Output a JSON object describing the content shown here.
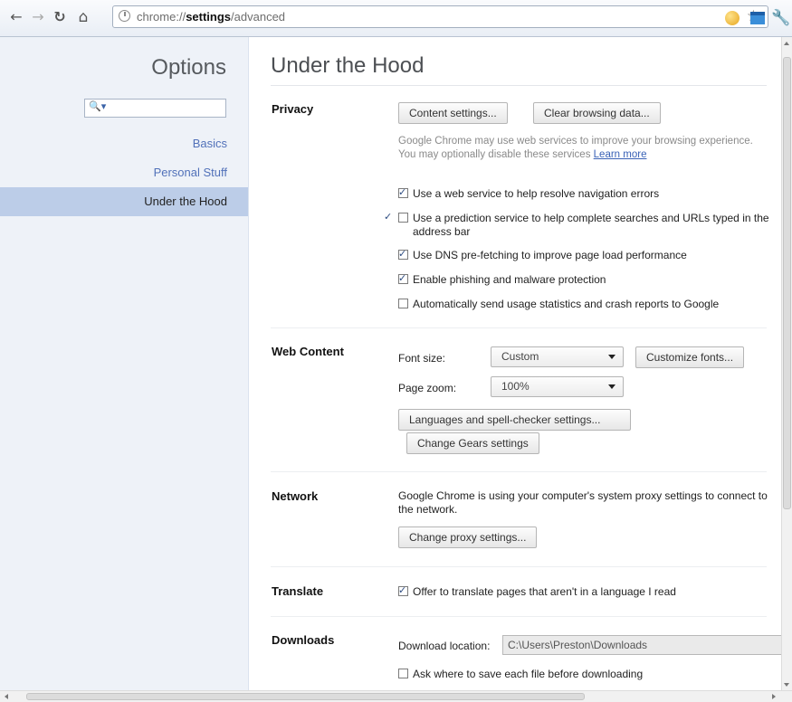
{
  "toolbar": {
    "back_icon": "back-arrow-icon",
    "forward_icon": "forward-arrow-icon",
    "reload_icon": "reload-icon",
    "home_icon": "home-icon",
    "url_scheme": "chrome://",
    "url_host": "settings",
    "url_path": "/advanced",
    "bookmark_icon": "star-icon",
    "extension_icons": [
      "smiley-extension-icon",
      "calendar-extension-icon"
    ],
    "menu_icon": "wrench-icon"
  },
  "sidebar": {
    "title": "Options",
    "search": {
      "value": "",
      "placeholder": ""
    },
    "items": [
      {
        "label": "Basics",
        "active": false
      },
      {
        "label": "Personal Stuff",
        "active": false
      },
      {
        "label": "Under the Hood",
        "active": true
      }
    ]
  },
  "main": {
    "title": "Under the Hood",
    "privacy": {
      "heading": "Privacy",
      "content_settings_button": "Content settings...",
      "clear_browsing_button": "Clear browsing data...",
      "note_line1": "Google Chrome may use web services to improve your browsing experience.",
      "note_line2": "You may optionally disable these services ",
      "learn_more": "Learn more",
      "checkboxes": [
        {
          "label": "Use a web service to help resolve navigation errors",
          "checked": true
        },
        {
          "label": "Use a prediction service to help complete searches and URLs typed in the address bar",
          "checked": true
        },
        {
          "label": "Use DNS pre-fetching to improve page load performance",
          "checked": true
        },
        {
          "label": "Enable phishing and malware protection",
          "checked": true
        },
        {
          "label": "Automatically send usage statistics and crash reports to Google",
          "checked": false
        }
      ]
    },
    "web_content": {
      "heading": "Web Content",
      "font_size_label": "Font size:",
      "font_size_value": "Custom",
      "customize_fonts_button": "Customize fonts...",
      "page_zoom_label": "Page zoom:",
      "page_zoom_value": "100%",
      "languages_button": "Languages and spell-checker settings...",
      "gears_button": "Change Gears settings"
    },
    "network": {
      "heading": "Network",
      "text": "Google Chrome is using your computer's system proxy settings to connect to the network.",
      "proxy_button": "Change proxy settings..."
    },
    "translate": {
      "heading": "Translate",
      "checkbox_label": "Offer to translate pages that aren't in a language I read",
      "checked": true
    },
    "downloads": {
      "heading": "Downloads",
      "location_label": "Download location:",
      "location_value": "C:\\Users\\Preston\\Downloads",
      "ask_label": "Ask where to save each file before downloading",
      "ask_checked": false
    }
  }
}
